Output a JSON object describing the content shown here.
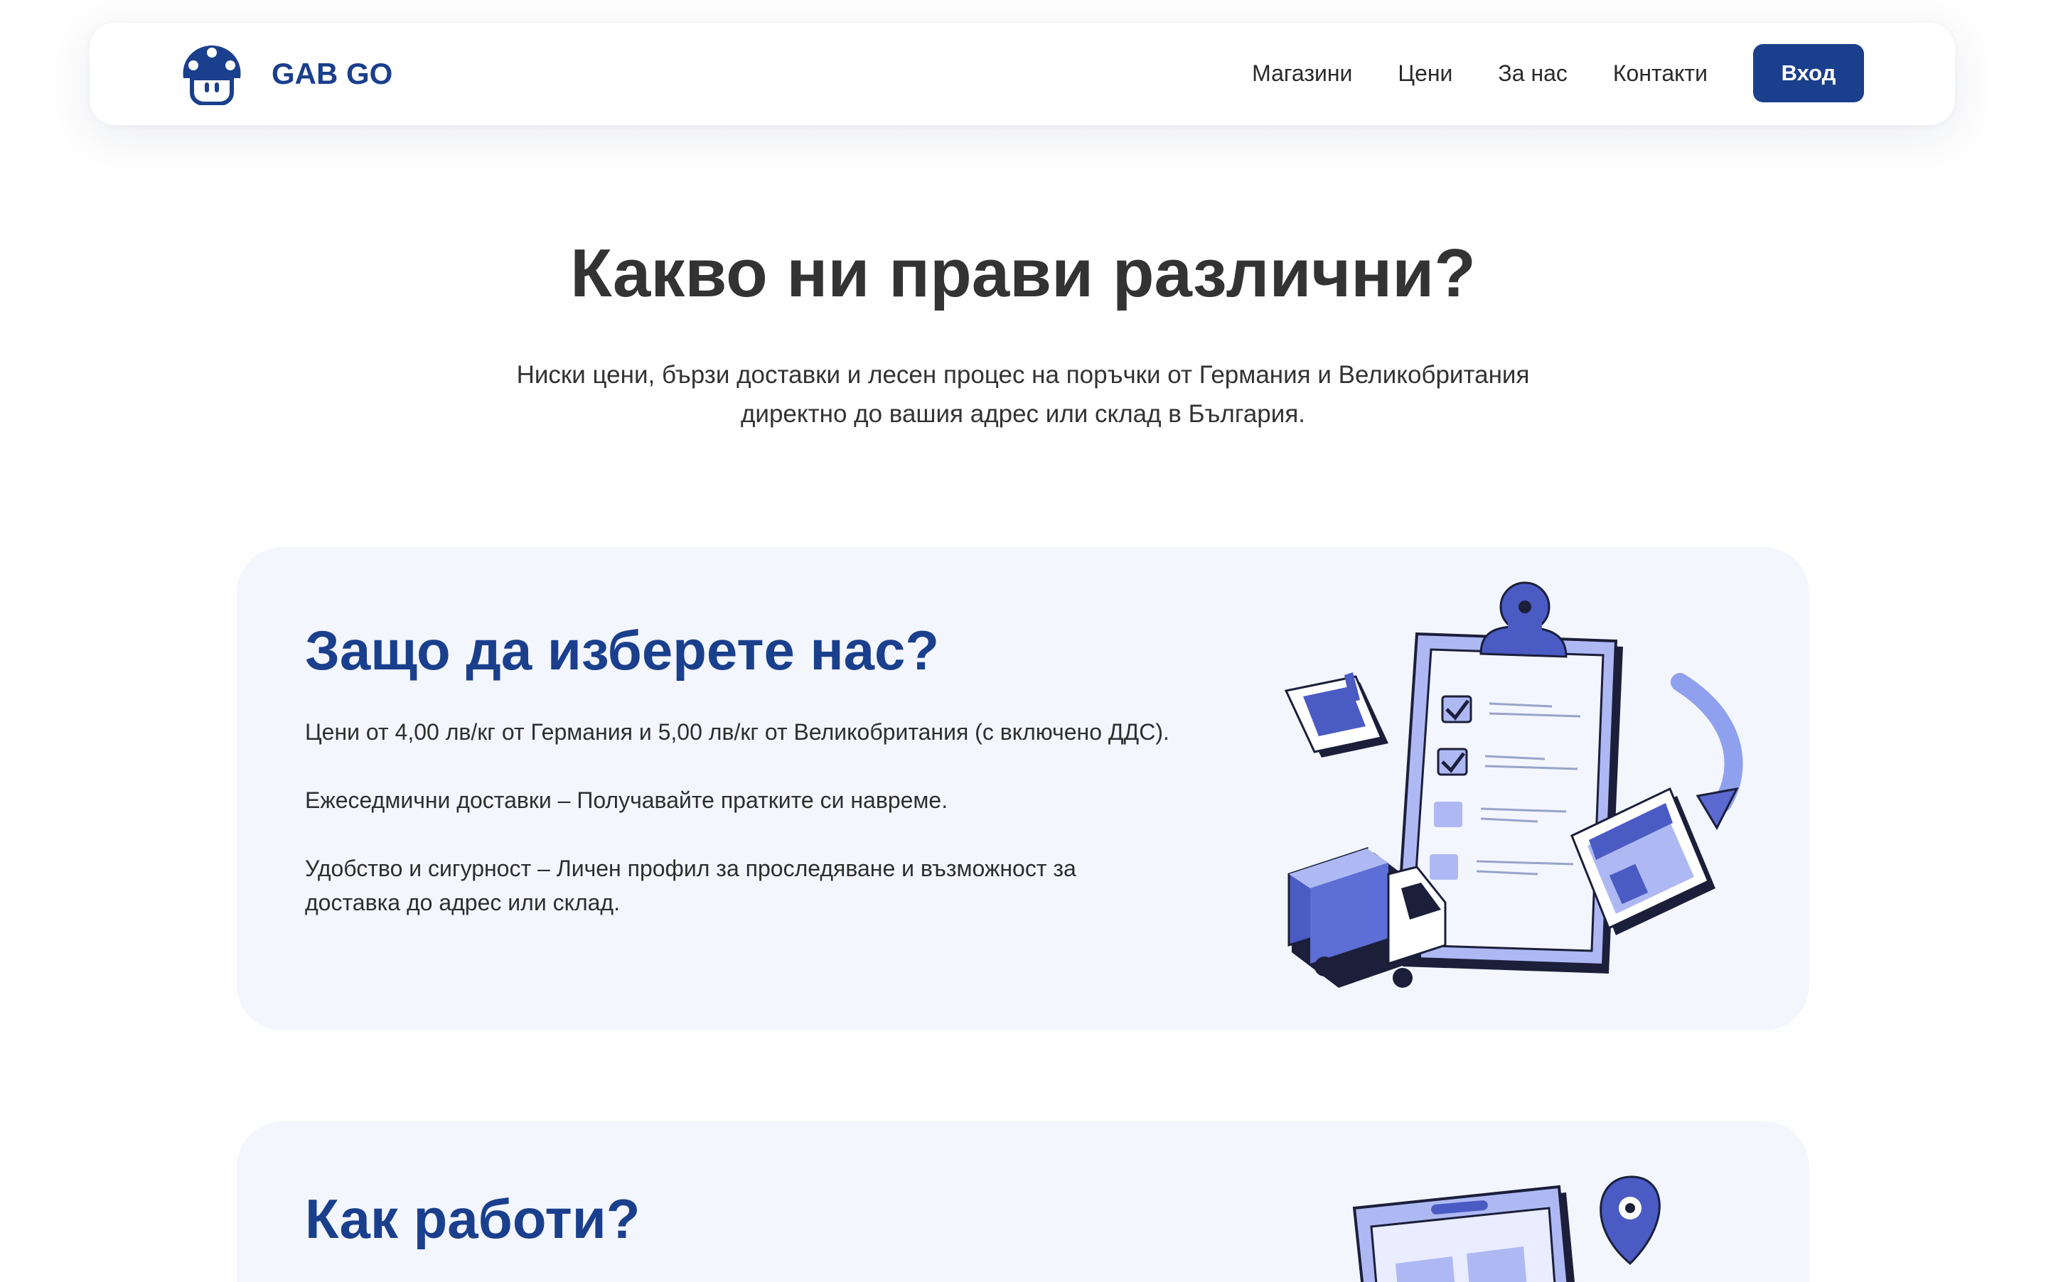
{
  "header": {
    "brand": "GAB GO",
    "nav": [
      "Магазини",
      "Цени",
      "За нас",
      "Контакти"
    ],
    "login_label": "Вход"
  },
  "hero": {
    "title": "Какво ни прави различни?",
    "subtitle_line1": "Ниски цени, бързи доставки и лесен процес на поръчки от Германия и Великобритания",
    "subtitle_line2": "директно до вашия адрес или склад в България."
  },
  "why_us": {
    "title": "Защо да изберете нас?",
    "points": [
      "Цени от 4,00 лв/кг от Германия и 5,00 лв/кг от Великобритания (с включено ДДС).",
      "Ежеседмични доставки – Получавайте пратките си навреме.",
      "Удобство и сигурност – Личен профил за проследяване и възможност за доставка до адрес или склад."
    ]
  },
  "how_it_works": {
    "title": "Как работи?"
  },
  "colors": {
    "brand": "#1a3f8c",
    "accent": "#4a5bc4",
    "accent_light": "#aeb9f4",
    "card_bg": "#f3f6fd"
  },
  "icons": [
    "mushroom-logo-icon",
    "clipboard-checklist-icon",
    "factory-icon",
    "truck-icon",
    "store-icon",
    "refresh-arrow-icon",
    "phone-map-icon",
    "location-pin-icon"
  ]
}
